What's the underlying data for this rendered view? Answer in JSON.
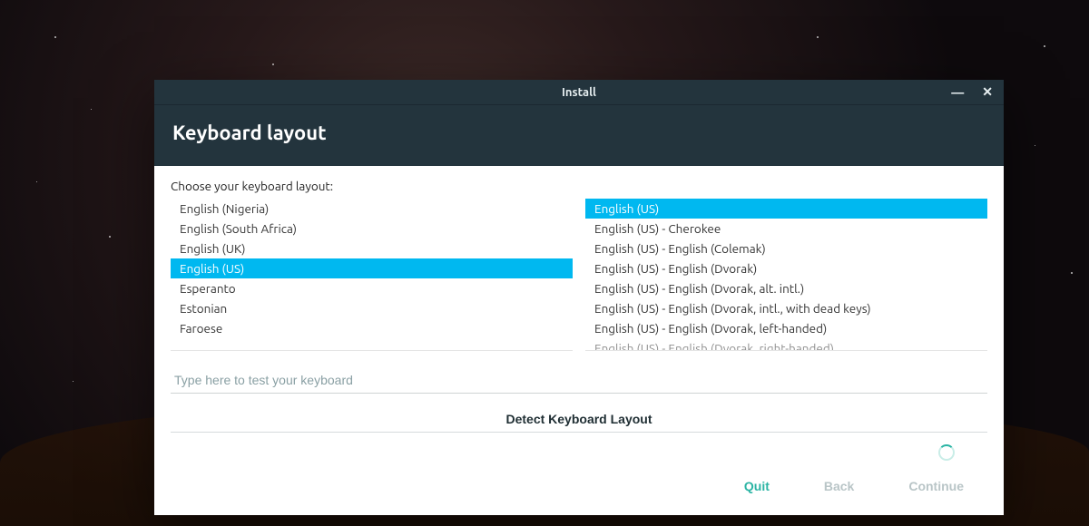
{
  "window": {
    "title": "Install"
  },
  "header": {
    "title": "Keyboard layout"
  },
  "prompt": "Choose your keyboard layout:",
  "layouts": {
    "selected_index": 3,
    "items": [
      "English (Nigeria)",
      "English (South Africa)",
      "English (UK)",
      "English (US)",
      "Esperanto",
      "Estonian",
      "Faroese"
    ]
  },
  "variants": {
    "selected_index": 0,
    "items": [
      "English (US)",
      "English (US) - Cherokee",
      "English (US) - English (Colemak)",
      "English (US) - English (Dvorak)",
      "English (US) - English (Dvorak, alt. intl.)",
      "English (US) - English (Dvorak, intl., with dead keys)",
      "English (US) - English (Dvorak, left-handed)",
      "English (US) - English (Dvorak, right-handed)"
    ]
  },
  "test_placeholder": "Type here to test your keyboard",
  "detect_label": "Detect Keyboard Layout",
  "footer": {
    "quit": "Quit",
    "back": "Back",
    "continue": "Continue"
  }
}
